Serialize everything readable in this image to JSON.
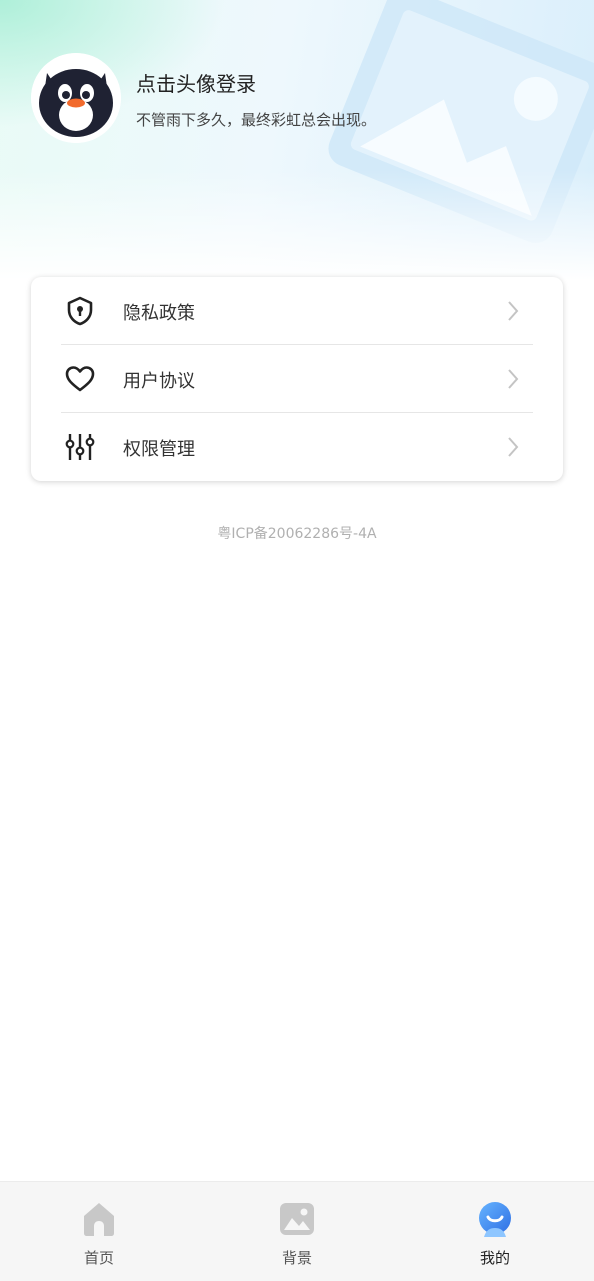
{
  "profile": {
    "login_title": "点击头像登录",
    "subtitle": "不管雨下多久，最终彩虹总会出现。"
  },
  "menu": {
    "items": [
      {
        "label": "隐私政策",
        "icon": "shield-lock-icon"
      },
      {
        "label": "用户协议",
        "icon": "heart-icon"
      },
      {
        "label": "权限管理",
        "icon": "sliders-icon"
      }
    ]
  },
  "footer": {
    "icp": "粤ICP备20062286号-4A"
  },
  "tabbar": {
    "tabs": [
      {
        "label": "首页",
        "icon": "home-icon",
        "active": false
      },
      {
        "label": "背景",
        "icon": "image-icon",
        "active": false
      },
      {
        "label": "我的",
        "icon": "profile-icon",
        "active": true
      }
    ]
  },
  "colors": {
    "accent": "#3a86f0",
    "inactive_icon": "#c8c8c8",
    "text_primary": "#222222",
    "text_muted": "#b0b0b0"
  }
}
